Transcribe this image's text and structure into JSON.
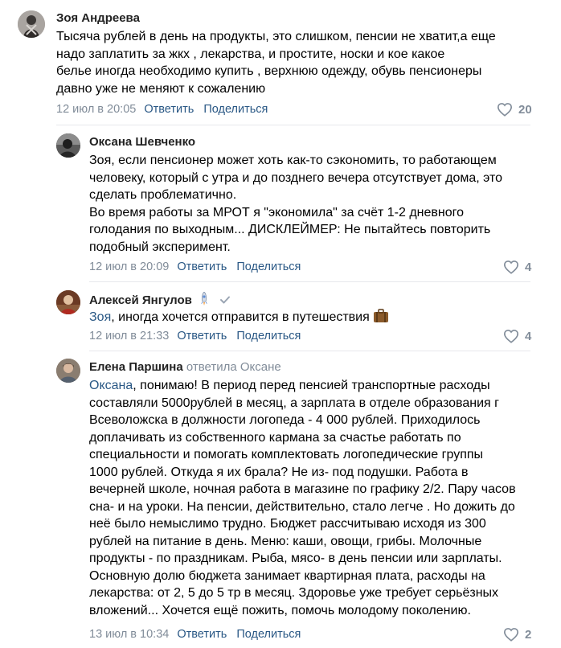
{
  "comments": [
    {
      "author": "Зоя Андреева",
      "lines": [
        "Тысяча рублей в день на продукты, это слишком, пенсии не хватит,а еще",
        "надо заплатить за жкх , лекарства, и простите, носки и кое какое",
        "белье иногда необходимо купить , верхнюю одежду, обувь пенсионеры",
        "давно уже не меняют к сожалению"
      ],
      "date": "12 июл в 20:05",
      "reply": "Ответить",
      "share": "Поделиться",
      "likes": "20"
    },
    {
      "author": "Оксана Шевченко",
      "lines": [
        "Зоя, если пенсионер может хоть как-то сэкономить, то работающем",
        "человеку, который с утра и до позднего вечера отсутствует дома, это",
        "сделать проблематично.",
        "Во время работы за МРОТ я \"экономила\" за счёт 1-2 дневного",
        "голодания по выходным... ДИСКЛЕЙМЕР: Не пытайтесь повторить",
        "подобный эксперимент."
      ],
      "date": "12 июл в 20:09",
      "reply": "Ответить",
      "share": "Поделиться",
      "likes": "4"
    },
    {
      "author": "Алексей Янгулов",
      "mention": "Зоя",
      "text_rest": ", иногда хочется отправится в путешествия",
      "date": "12 июл в 21:33",
      "reply": "Ответить",
      "share": "Поделиться",
      "likes": "4"
    },
    {
      "author": "Елена Паршина",
      "reply_to": "ответила Оксане",
      "mention": "Оксана",
      "first_line_rest": ", понимаю! В период перед пенсией транспортные расходы",
      "lines": [
        "составляли 5000рублей в месяц, а зарплата в отделе образования г",
        "Всеволожска в должности логопеда - 4 000 рублей. Приходилось",
        "доплачивать из собственного кармана за счастье работать по",
        "специальности и помогать комплектовать логопедические группы",
        "1000 рублей. Откуда я их брала? Не из- под подушки. Работа в",
        "вечерней школе, ночная работа в магазине по графику 2/2. Пару часов",
        "сна- и на уроки. На пенсии, действительно, стало легче . Но дожить до",
        "неё было немыслимо трудно. Бюджет рассчитываю исходя из 300",
        "рублей на питание в день. Меню: каши, овощи, грибы. Молочные",
        "продукты - по праздникам. Рыба, мясо- в день пенсии или зарплаты.",
        "Основную долю бюджета занимает квартирная плата, расходы на",
        "лекарства: от 2, 5 до 5 тр в месяц. Здоровье уже требует серьёзных",
        "вложений... Хочется ещё пожить, помочь молодому поколению."
      ],
      "date": "13 июл в 10:34",
      "reply": "Ответить",
      "share": "Поделиться",
      "likes": "2"
    }
  ],
  "colors": {
    "link": "#2a5885",
    "meta": "#818c99",
    "separator": "#e7e8ec"
  },
  "icons": [
    "heart-icon",
    "rocket-icon",
    "checkmark-icon",
    "suitcase-icon"
  ]
}
